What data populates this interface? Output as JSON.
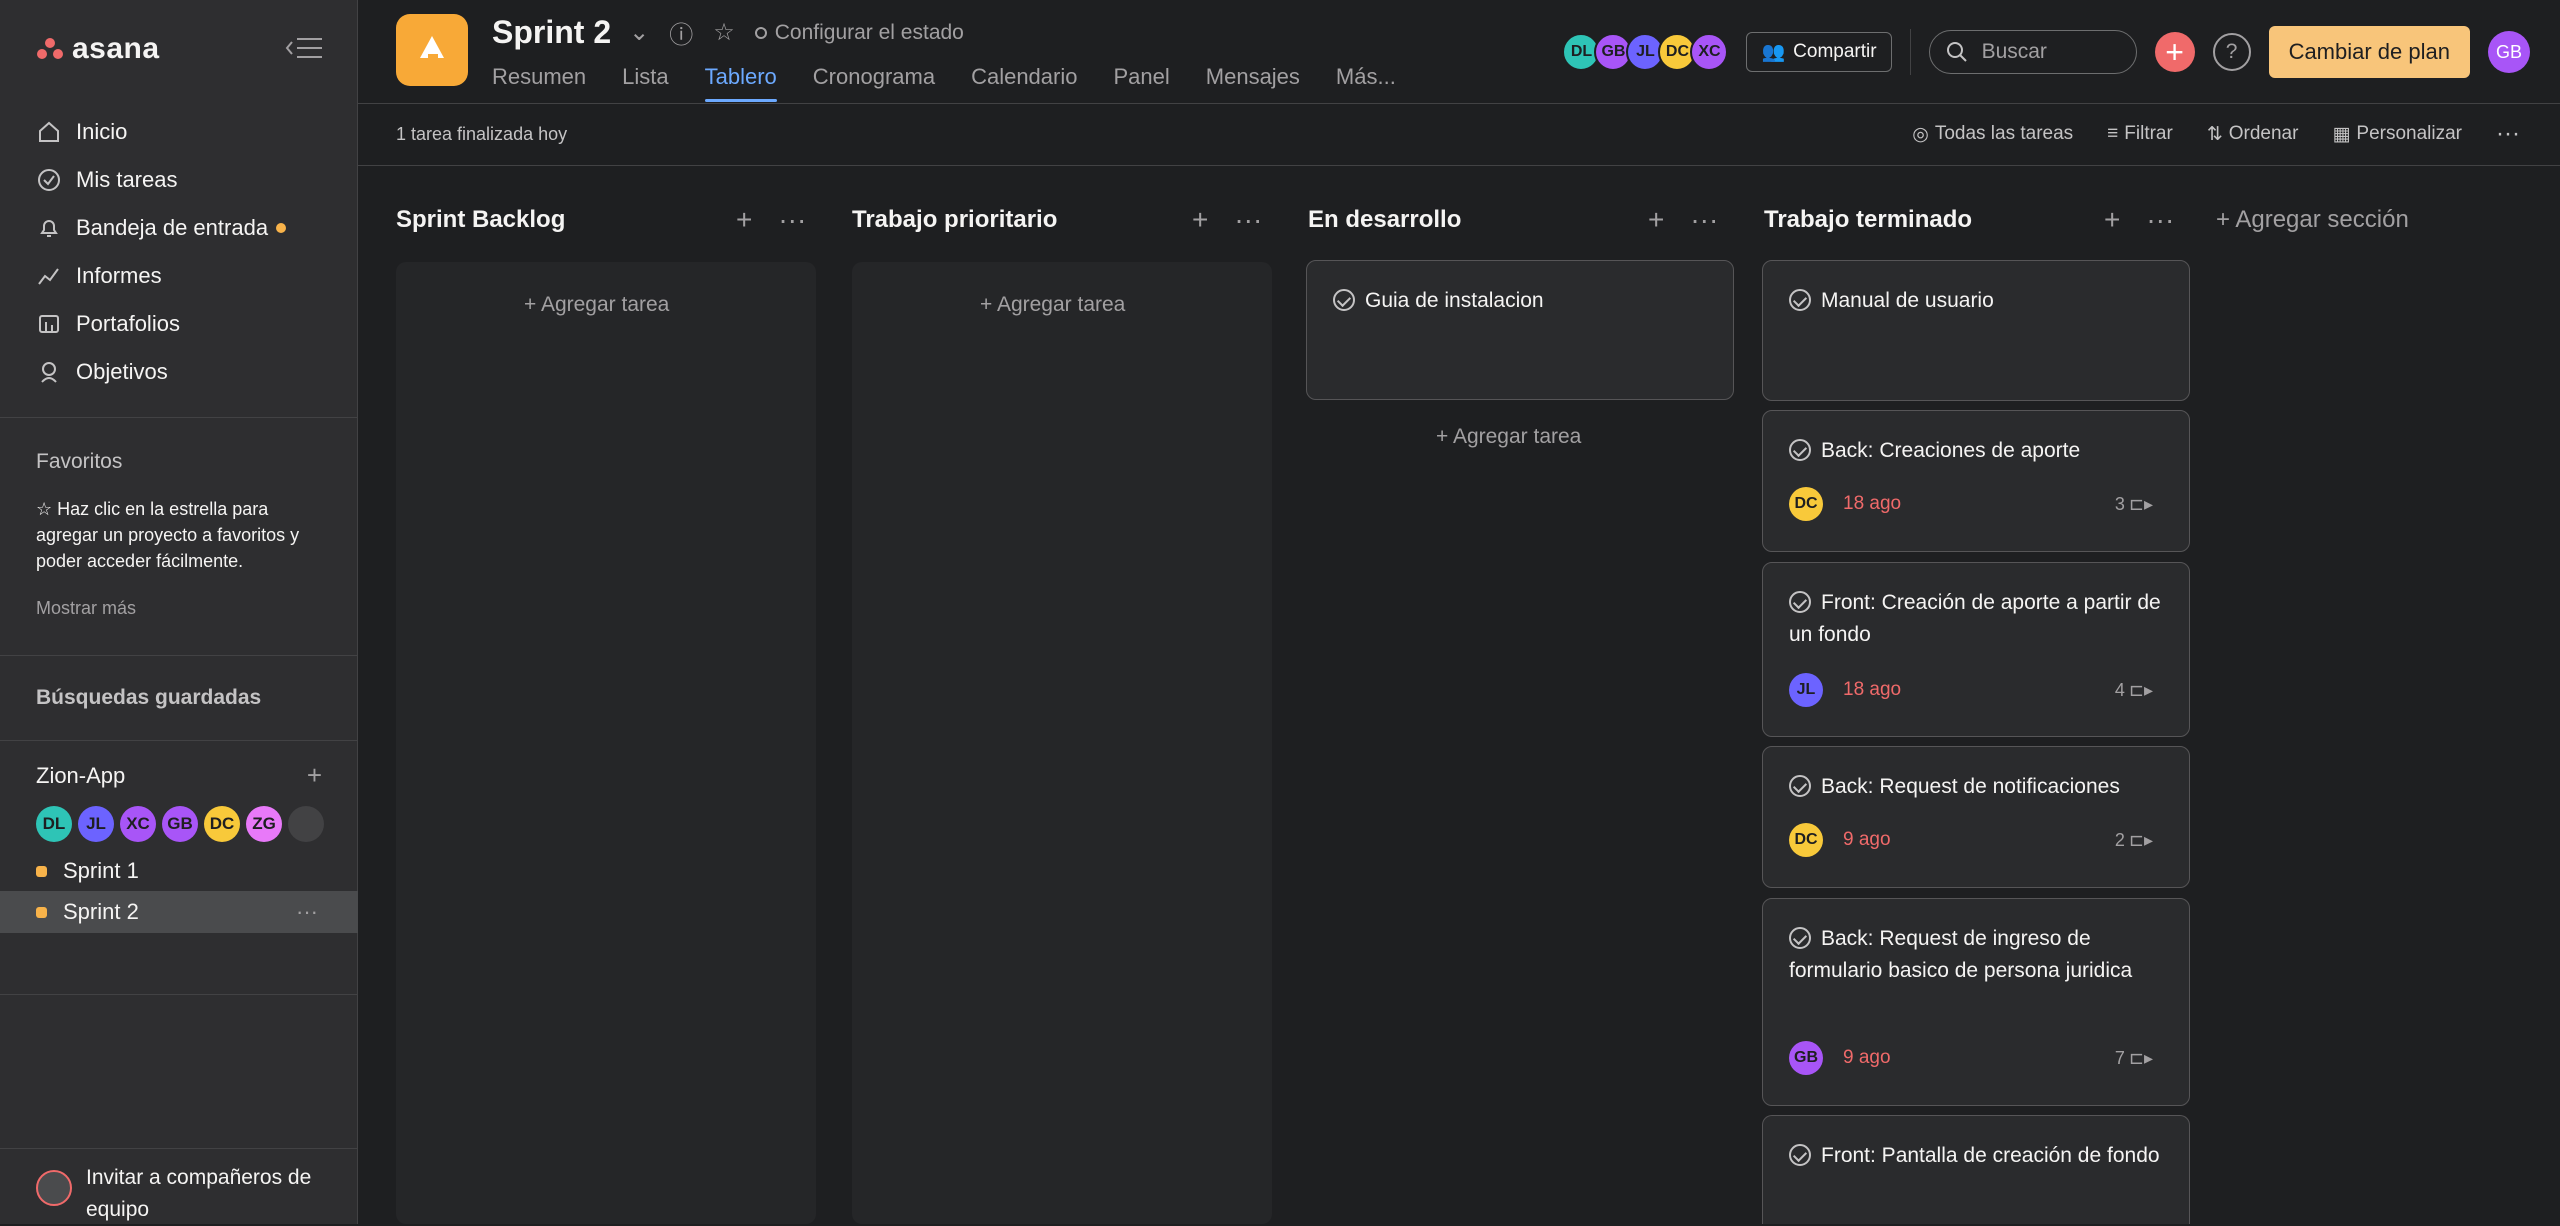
{
  "sidebar": {
    "brand": "asana",
    "nav": [
      {
        "label": "Inicio",
        "icon": "home-icon"
      },
      {
        "label": "Mis tareas",
        "icon": "check-circle-icon"
      },
      {
        "label": "Bandeja de entrada",
        "icon": "bell-icon"
      },
      {
        "label": "Informes",
        "icon": "chart-line-icon"
      },
      {
        "label": "Portafolios",
        "icon": "folder-icon"
      },
      {
        "label": "Objetivos",
        "icon": "person-target-icon"
      }
    ],
    "favorites_title": "Favoritos",
    "favorites_hint": "☆ Haz clic en la estrella para agregar un proyecto a favoritos y poder acceder fácilmente.",
    "show_more": "Mostrar más",
    "saved_searches": "Búsquedas guardadas",
    "team": {
      "name": "Zion-App",
      "members": [
        {
          "initials": "DL",
          "color": "#2ec4b6"
        },
        {
          "initials": "JL",
          "color": "#6c63ff"
        },
        {
          "initials": "XC",
          "color": "#a855f7"
        },
        {
          "initials": "GB",
          "color": "#a855f7"
        },
        {
          "initials": "DC",
          "color": "#f8c93a"
        },
        {
          "initials": "ZG",
          "color": "#e879f9"
        }
      ]
    },
    "projects": [
      {
        "label": "Sprint 1"
      },
      {
        "label": "Sprint 2"
      }
    ],
    "invite": "Invitar a compañeros de equipo"
  },
  "header": {
    "project_title": "Sprint 2",
    "status": "Configurar el estado",
    "tabs": [
      "Resumen",
      "Lista",
      "Tablero",
      "Cronograma",
      "Calendario",
      "Panel",
      "Mensajes",
      "Más..."
    ],
    "active_tab": "Tablero",
    "member_stack": [
      {
        "initials": "DL",
        "color": "#2ec4b6"
      },
      {
        "initials": "GB",
        "color": "#a855f7"
      },
      {
        "initials": "JL",
        "color": "#6c63ff"
      },
      {
        "initials": "DC",
        "color": "#f8c93a"
      },
      {
        "initials": "XC",
        "color": "#a855f7"
      }
    ],
    "share": "Compartir",
    "search_placeholder": "Buscar",
    "upgrade": "Cambiar de plan",
    "user_initials": "GB"
  },
  "toolbar": {
    "done_today": "1 tarea finalizada hoy",
    "all_tasks": "Todas las tareas",
    "filter": "Filtrar",
    "sort": "Ordenar",
    "customize": "Personalizar"
  },
  "board": {
    "add_task": "+ Agregar tarea",
    "add_section": "+ Agregar sección",
    "columns": [
      "Sprint Backlog",
      "Trabajo prioritario",
      "En desarrollo",
      "Trabajo terminado"
    ],
    "dev_card": "Guia de instalacion",
    "done_cards": [
      {
        "title": "Manual de usuario"
      },
      {
        "title": "Back: Creaciones de aporte",
        "assignee": "DC",
        "color": "#f8c93a",
        "due": "18 ago",
        "subtasks": "3"
      },
      {
        "title": "Front: Creación de aporte a partir de un fondo",
        "assignee": "JL",
        "color": "#6c63ff",
        "due": "18 ago",
        "subtasks": "4"
      },
      {
        "title": "Back: Request de notificaciones",
        "assignee": "DC",
        "color": "#f8c93a",
        "due": "9 ago",
        "subtasks": "2"
      },
      {
        "title": "Back: Request de ingreso de formulario basico de persona juridica",
        "assignee": "GB",
        "color": "#a855f7",
        "due": "9 ago",
        "subtasks": "7"
      },
      {
        "title": "Front: Pantalla de creación de fondo"
      }
    ]
  }
}
